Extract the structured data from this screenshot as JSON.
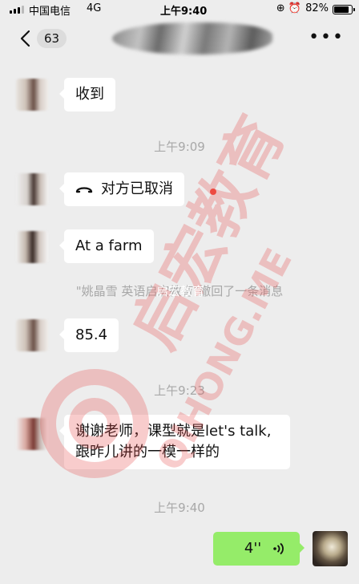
{
  "status_bar": {
    "carrier": "中国电信",
    "network": "4G",
    "time": "上午9:40",
    "icons": "⊕ ⏰",
    "battery": "82%"
  },
  "nav": {
    "unread_count": "63",
    "more": "•••"
  },
  "messages": [
    {
      "type": "in",
      "text": "收到"
    },
    {
      "type": "time",
      "text": "上午9:09"
    },
    {
      "type": "in_call",
      "text": "对方已取消"
    },
    {
      "type": "in",
      "text": "At a farm"
    },
    {
      "type": "system",
      "text": "\"姚晶雪 英语启宏教育\"撤回了一条消息"
    },
    {
      "type": "in",
      "text": "85.4"
    },
    {
      "type": "time",
      "text": "上午9:23"
    },
    {
      "type": "in",
      "text_line1": "谢谢老师，课型就是let's talk,",
      "text_line2": "跟昨儿讲的一模一样的"
    },
    {
      "type": "time",
      "text": "上午9:40"
    },
    {
      "type": "out_voice",
      "text": "4''"
    }
  ],
  "watermark": {
    "name": "启宏教育",
    "pinyin": "QIHONG.ME",
    "overlay": "启宏教育",
    "color": "#e74c4c"
  },
  "colors": {
    "background": "#ededed",
    "bubble_in": "#ffffff",
    "bubble_out": "#95ec69",
    "timestamp": "#a8a8a8",
    "unread_dot": "#f04a3e"
  },
  "icons": [
    "signal-icon",
    "back-chevron-icon",
    "more-icon",
    "call-declined-icon",
    "voice-wave-icon",
    "alarm-icon",
    "lock-rotation-icon",
    "battery-icon"
  ]
}
